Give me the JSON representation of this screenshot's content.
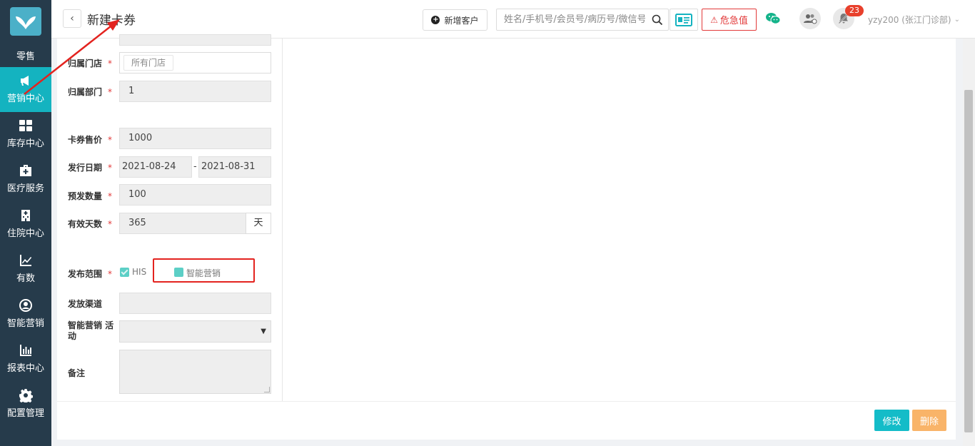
{
  "sidebar": {
    "items": [
      {
        "label": "零售"
      },
      {
        "label": "营销中心"
      },
      {
        "label": "库存中心"
      },
      {
        "label": "医疗服务"
      },
      {
        "label": "住院中心"
      },
      {
        "label": "有数"
      },
      {
        "label": "智能营销"
      },
      {
        "label": "报表中心"
      },
      {
        "label": "配置管理"
      }
    ]
  },
  "header": {
    "title": "新建卡券",
    "back_icon": "‹",
    "add_customer_label": "新增客户",
    "search_placeholder": "姓名/手机号/会员号/病历号/微信号",
    "danger_label": "危急值",
    "notification_count": "23",
    "user_label": "yzy200 (张江门诊部)"
  },
  "form": {
    "store_label": "归属门店",
    "store_value": "所有门店",
    "dept_label": "归属部门",
    "dept_value": "1",
    "price_label": "卡券售价",
    "price_value": "1000",
    "issue_date_label": "发行日期",
    "issue_start": "2021-08-24",
    "issue_end": "2021-08-31",
    "date_separator": "-",
    "preset_qty_label": "预发数量",
    "preset_qty_value": "100",
    "valid_days_label": "有效天数",
    "valid_days_value": "365",
    "valid_days_unit": "天",
    "publish_scope_label": "发布范围",
    "scope_his": "HIS",
    "scope_smart": "智能营销",
    "channel_label": "发放渠道",
    "smart_activity_label": "智能营销 活动",
    "remark_label": "备注",
    "required_mark": "*"
  },
  "footer": {
    "edit_label": "修改",
    "delete_label": "删除"
  },
  "colors": {
    "sidebar_bg": "#263b4b",
    "active": "#14b3c0",
    "danger": "#e23a3a",
    "edit_btn": "#14bcc8",
    "delete_btn": "#f9b469"
  }
}
